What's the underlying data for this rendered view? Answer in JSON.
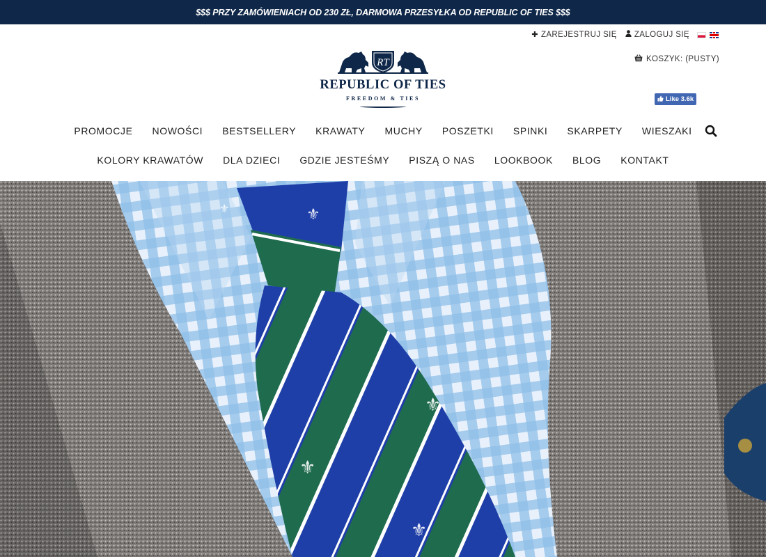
{
  "promo": {
    "text": "$$$ PRZY ZAMÓWIENIACH OD 230 ZŁ, DARMOWA PRZESYŁKA OD REPUBLIC OF TIES $$$"
  },
  "account": {
    "register_label": "ZAREJESTRUJ SIĘ",
    "register_icon": "plus-icon",
    "login_label": "ZALOGUJ SIĘ",
    "login_icon": "user-icon",
    "languages": [
      "pl",
      "en"
    ]
  },
  "cart": {
    "label": "KOSZYK: (PUSTY)",
    "icon": "basket-icon"
  },
  "facebook": {
    "label": "Like 3.6k"
  },
  "logo": {
    "monogram": "RT",
    "name": "REPUBLIC OF TIES",
    "tagline": "FREEDOM & TIES"
  },
  "nav": {
    "row1": [
      "PROMOCJE",
      "NOWOŚCI",
      "BESTSELLERY",
      "KRAWATY",
      "MUCHY",
      "POSZETKI",
      "SPINKI",
      "SKARPETY",
      "WIESZAKI"
    ],
    "row2": [
      "KOLORY KRAWATÓW",
      "DLA DZIECI",
      "GDZIE JESTEŚMY",
      "PISZĄ O NAS",
      "LOOKBOOK",
      "BLOG",
      "KONTAKT"
    ]
  },
  "colors": {
    "brand_navy": "#0f2748",
    "promo_text": "#ffffff",
    "facebook_blue": "#4267b2"
  }
}
